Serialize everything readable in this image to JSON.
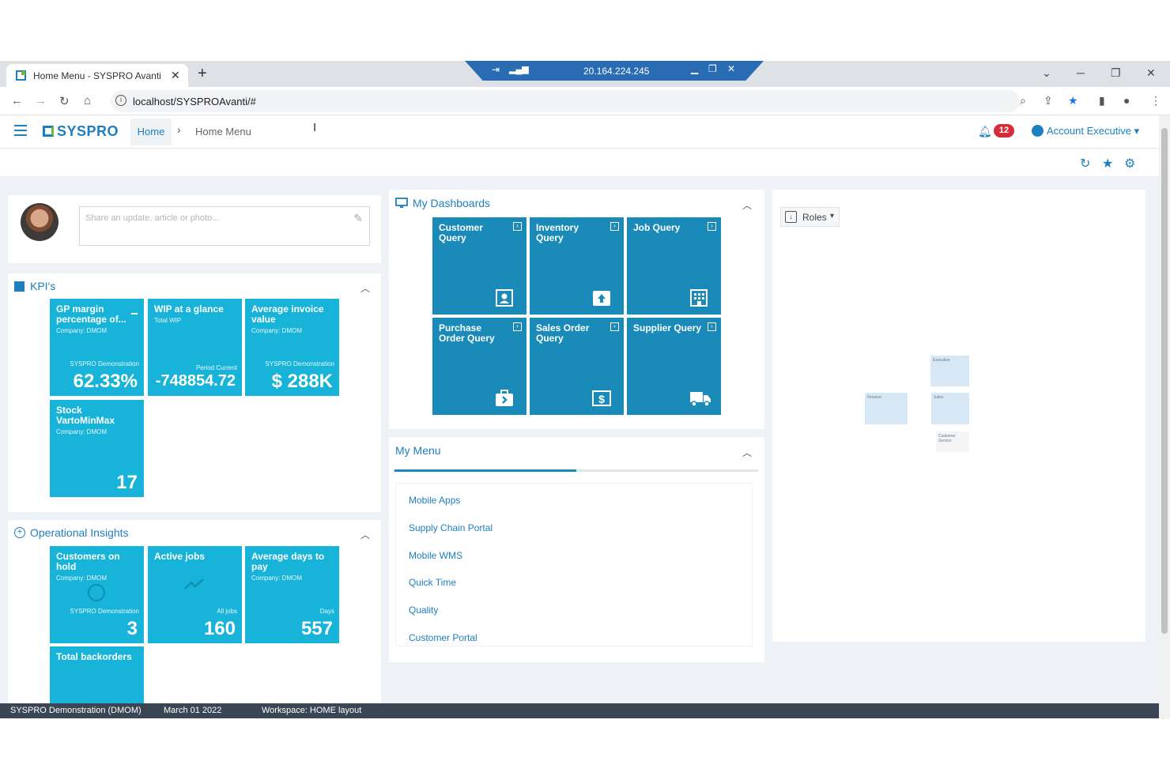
{
  "browser": {
    "tab_title": "Home Menu - SYSPRO Avanti",
    "tab_close": "✕",
    "new_tab": "+",
    "remote_ip": "20.164.224.245",
    "url": "localhost/SYSPROAvanti/#"
  },
  "header": {
    "logo_text": "SYSPRO",
    "breadcrumb_home": "Home",
    "breadcrumb_separator": "›",
    "breadcrumb_current": "Home Menu",
    "notification_count": "12",
    "account_label": "Account Executive",
    "account_caret": "▾"
  },
  "feed": {
    "placeholder": "Share an update, article or photo..."
  },
  "kpis": {
    "title": "KPI's",
    "tiles": [
      {
        "title": "GP margin percentage of...",
        "sub": "Company: DMOM",
        "caption": "SYSPRO Demonstration",
        "value": "62.33%"
      },
      {
        "title": "WIP at a glance",
        "sub": "Total WIP",
        "caption": "Period Current",
        "value": "-748854.72"
      },
      {
        "title": "Average invoice value",
        "sub": "Company: DMOM",
        "caption": "SYSPRO Demonstration",
        "value": "$ 288K"
      },
      {
        "title": "Stock VartoMinMax",
        "sub": "Company: DMOM",
        "caption": "",
        "value": "17"
      }
    ]
  },
  "insights": {
    "title": "Operational Insights",
    "tiles": [
      {
        "title": "Customers on hold",
        "sub": "Company: DMOM",
        "caption": "SYSPRO Demonstration",
        "value": "3"
      },
      {
        "title": "Active jobs",
        "sub": "",
        "caption": "All jobs",
        "value": "160"
      },
      {
        "title": "Average days to pay",
        "sub": "Company: DMOM",
        "caption": "Days",
        "value": "557"
      },
      {
        "title": "Total backorders",
        "sub": "",
        "caption": "",
        "value": ""
      }
    ]
  },
  "dashboards": {
    "title": "My Dashboards",
    "tiles": [
      {
        "title": "Customer Query",
        "icon": "contact-card-icon"
      },
      {
        "title": "Inventory Query",
        "icon": "box-icon"
      },
      {
        "title": "Job Query",
        "icon": "building-icon"
      },
      {
        "title": "Purchase Order Query",
        "icon": "briefcase-icon"
      },
      {
        "title": "Sales Order Query",
        "icon": "dollar-icon"
      },
      {
        "title": "Supplier Query",
        "icon": "truck-icon"
      }
    ]
  },
  "menu": {
    "title": "My Menu",
    "items": [
      "Mobile Apps",
      "Supply Chain Portal",
      "Mobile WMS",
      "Quick Time",
      "Quality",
      "Customer Portal"
    ]
  },
  "roles": {
    "label": "Roles",
    "caret": "▾",
    "nodes": [
      "Executive",
      "Finance",
      "Sales",
      "Customer Service"
    ]
  },
  "status": {
    "company": "SYSPRO Demonstration (DMOM)",
    "date": "March 01 2022",
    "workspace": "Workspace: HOME layout"
  },
  "colors": {
    "accent": "#1d7fbf",
    "kpi_tile": "#17b3d9",
    "dashboard_tile": "#1a8bb9",
    "badge": "#d62b3a"
  }
}
